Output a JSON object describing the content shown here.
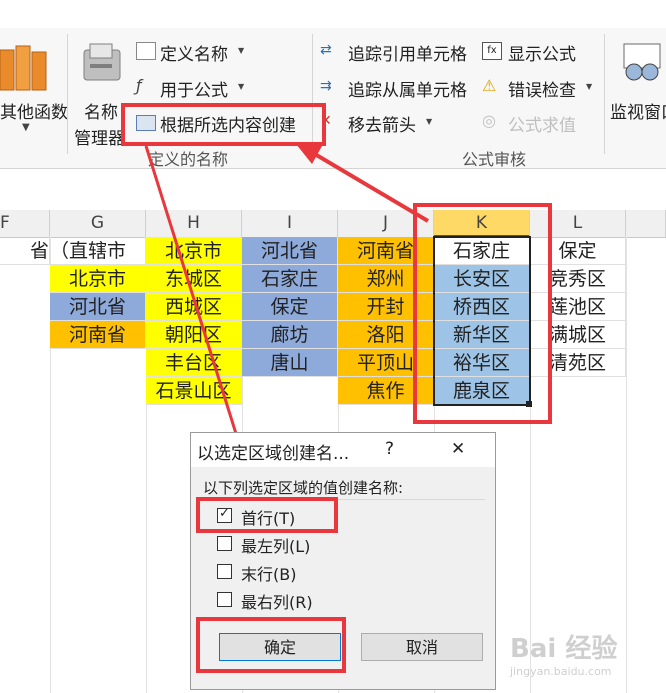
{
  "ribbon": {
    "more_functions_label": "其他函数",
    "name_manager_line1": "名称",
    "name_manager_line2": "管理器",
    "define_name": "定义名称",
    "use_in_formula": "用于公式",
    "create_from_selection": "根据所选内容创建",
    "defined_names_group": "定义的名称",
    "trace_precedents": "追踪引用单元格",
    "trace_dependents": "追踪从属单元格",
    "remove_arrows": "移去箭头",
    "show_formulas": "显示公式",
    "error_checking": "错误检查",
    "evaluate_formula": "公式求值",
    "formula_auditing_group": "公式审核",
    "watch_window": "监视窗口"
  },
  "columns": [
    "F",
    "G",
    "H",
    "I",
    "J",
    "K",
    "L"
  ],
  "rows": {
    "r1": {
      "F": "省",
      "G": "（直辖市",
      "H": "北京市",
      "I": "河北省",
      "J": "河南省",
      "K": "石家庄",
      "L": "保定"
    },
    "r2": {
      "G": "北京市",
      "H": "东城区",
      "I": "石家庄",
      "J": "郑州",
      "K": "长安区",
      "L": "竞秀区"
    },
    "r3": {
      "G": "河北省",
      "H": "西城区",
      "I": "保定",
      "J": "开封",
      "K": "桥西区",
      "L": "莲池区"
    },
    "r4": {
      "G": "河南省",
      "H": "朝阳区",
      "I": "廊坊",
      "J": "洛阳",
      "K": "新华区",
      "L": "满城区"
    },
    "r5": {
      "H": "丰台区",
      "I": "唐山",
      "J": "平顶山",
      "K": "裕华区",
      "L": "清苑区"
    },
    "r6": {
      "H": "石景山区",
      "J": "焦作",
      "K": "鹿泉区"
    }
  },
  "dialog": {
    "title": "以选定区域创建名...",
    "help": "?",
    "close": "✕",
    "prompt": "以下列选定区域的值创建名称:",
    "options": [
      {
        "label": "首行(T)",
        "checked": true
      },
      {
        "label": "最左列(L)",
        "checked": false
      },
      {
        "label": "末行(B)",
        "checked": false
      },
      {
        "label": "最右列(R)",
        "checked": false
      }
    ],
    "ok": "确定",
    "cancel": "取消"
  },
  "watermark": "Bai 经验",
  "watermark_url": "jingyan.baidu.com",
  "colors": {
    "annotation_red": "#e8383d",
    "yellow": "#ffff00",
    "blue": "#8eaadb",
    "orange": "#ffc000",
    "selection": "#9dc3e6"
  }
}
